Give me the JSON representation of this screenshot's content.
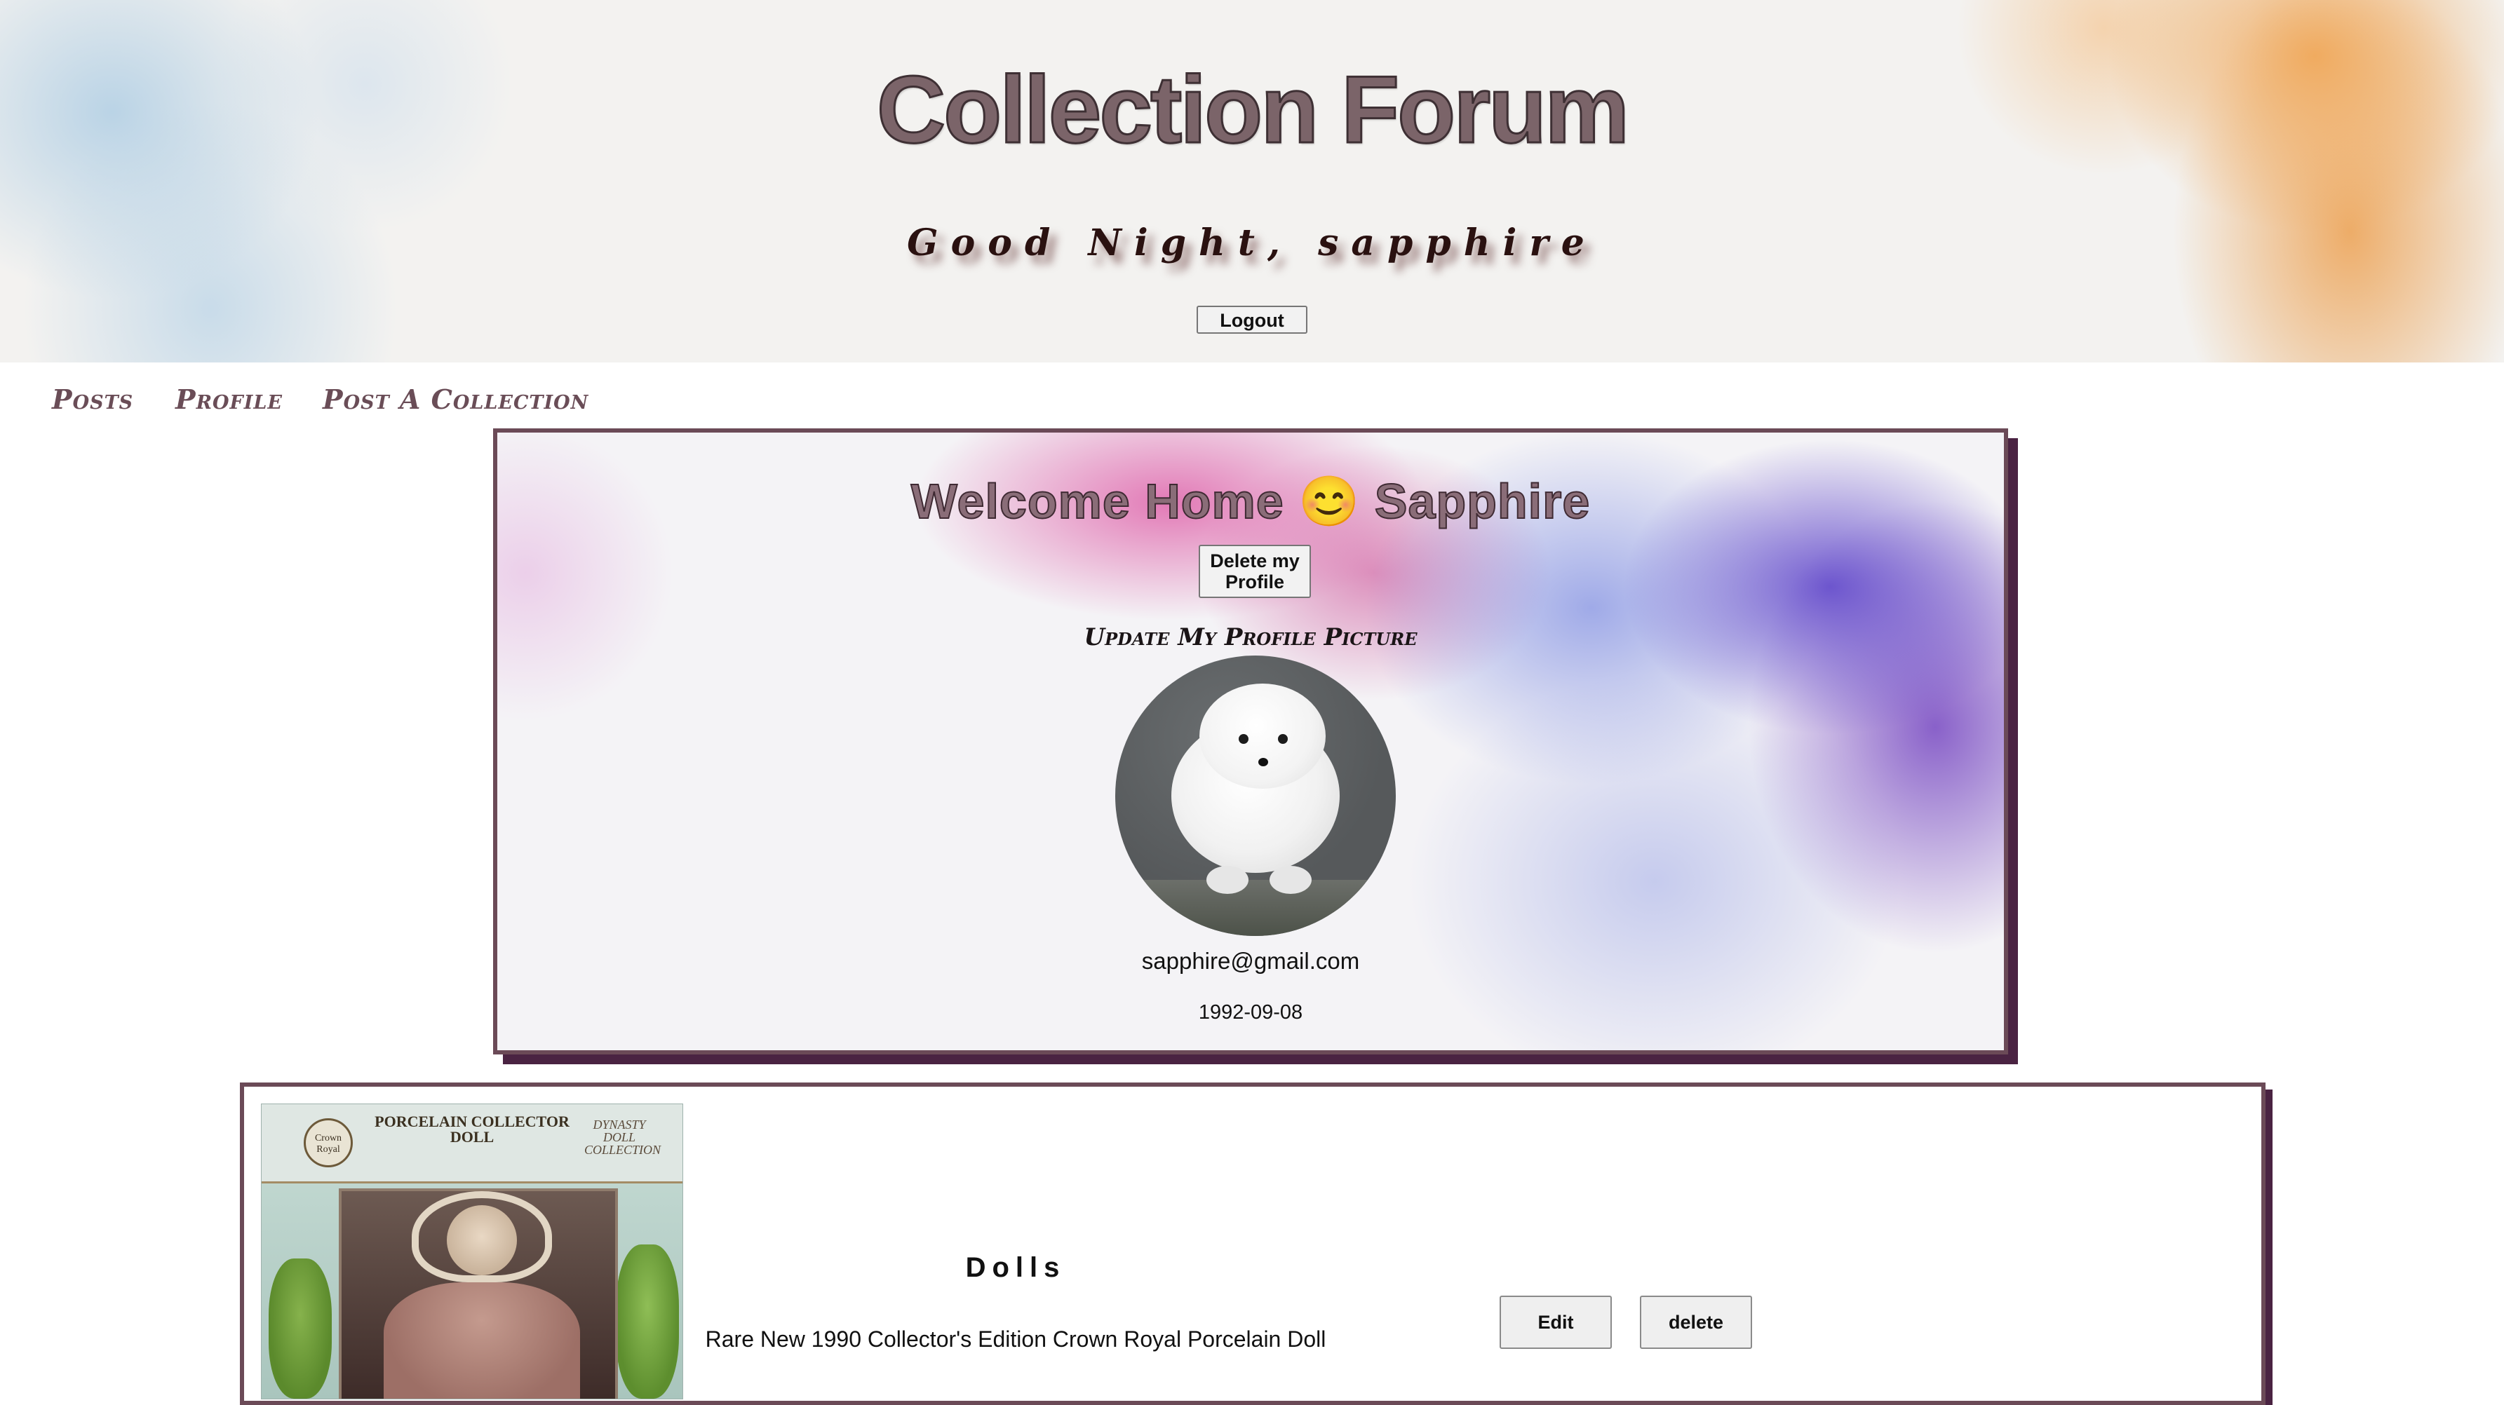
{
  "header": {
    "title": "Collection Forum",
    "greeting": "Good Night, sapphire",
    "logout_label": "Logout"
  },
  "nav": {
    "items": [
      {
        "label": "Posts"
      },
      {
        "label": "Profile"
      },
      {
        "label": "Post A Collection"
      }
    ]
  },
  "profile": {
    "welcome": "Welcome Home 😊 Sapphire",
    "delete_label": "Delete my Profile",
    "update_picture_label": "Update My Profile Picture",
    "email": "sapphire@gmail.com",
    "birthdate": "1992-09-08"
  },
  "posts": [
    {
      "category": "Dolls",
      "description": "Rare New 1990 Collector's Edition Crown Royal Porcelain Doll",
      "edit_label": "Edit",
      "delete_label": "delete",
      "image_text": {
        "box_title": "PORCELAIN COLLECTOR DOLL",
        "brand_left": "Crown Royal",
        "brand_right": "DYNASTY DOLL COLLECTION"
      }
    }
  ],
  "colors": {
    "card_border": "#6b4a57",
    "card_shadow": "#4a2342",
    "nav_text": "#6a4d57"
  }
}
